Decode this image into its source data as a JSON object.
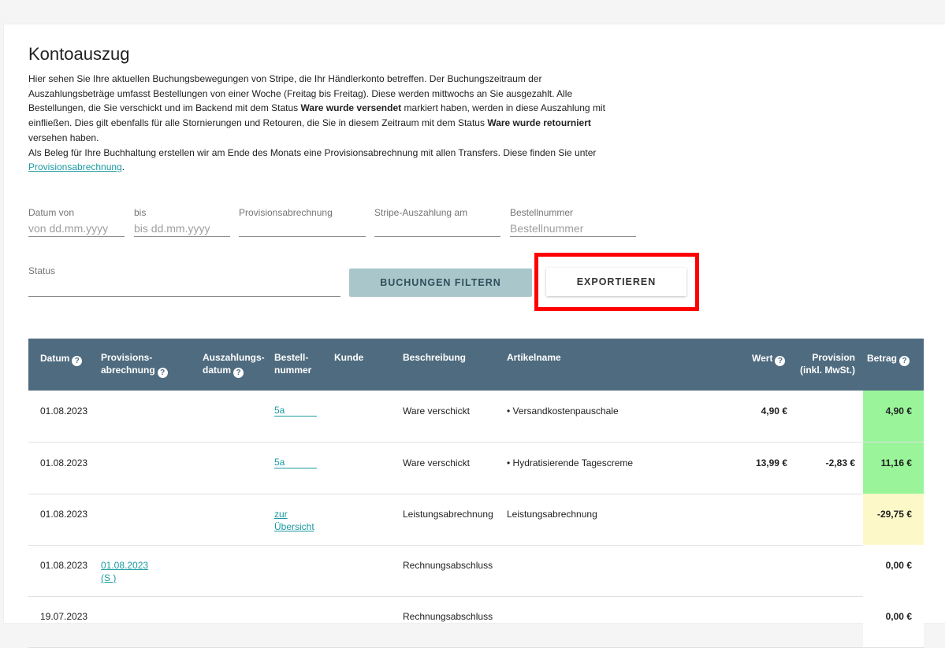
{
  "title": "Kontoauszug",
  "intro": {
    "p1": "Hier sehen Sie Ihre aktuellen Buchungsbewegungen von Stripe, die Ihr Händlerkonto betreffen. Der Buchungszeitraum der Auszahlungsbeträge umfasst Bestellungen von einer Woche (Freitag bis Freitag). Diese werden mittwochs an Sie ausgezahlt. Alle Bestellungen, die Sie verschickt und im Backend mit dem Status ",
    "b1": "Ware wurde versendet",
    "p2": " markiert haben, werden in diese Auszahlung mit einfließen. Dies gilt ebenfalls für alle Stornierungen und Retouren, die Sie in diesem Zeitraum mit dem Status ",
    "b2": "Ware wurde retourniert",
    "p3": " versehen haben.",
    "p4": "Als Beleg für Ihre Buchhaltung erstellen wir am Ende des Monats eine Provisionsabrechnung mit allen Transfers. Diese finden Sie unter ",
    "link": "Provisionsabrechnung",
    "p5": "."
  },
  "filters": {
    "datum_von": {
      "label": "Datum von",
      "placeholder": "von dd.mm.yyyy"
    },
    "bis": {
      "label": "bis",
      "placeholder": "bis dd.mm.yyyy"
    },
    "provisionsabrechnung": {
      "label": "Provisionsabrechnung",
      "value": ""
    },
    "stripe_auszahlung": {
      "label": "Stripe-Auszahlung am",
      "value": ""
    },
    "bestellnummer": {
      "label": "Bestellnummer",
      "placeholder": "Bestellnummer"
    },
    "status": {
      "label": "Status",
      "value": ""
    }
  },
  "buttons": {
    "filter": "BUCHUNGEN FILTERN",
    "export": "EXPORTIEREN"
  },
  "table": {
    "headers": {
      "datum": "Datum",
      "provisionsabrechnung_1": "Provisions-",
      "provisionsabrechnung_2": "abrechnung",
      "auszahlungsdatum_1": "Auszahlungs-",
      "auszahlungsdatum_2": "datum",
      "bestellnummer_1": "Bestell-",
      "bestellnummer_2": "nummer",
      "kunde": "Kunde",
      "beschreibung": "Beschreibung",
      "artikelname": "Artikelname",
      "wert": "Wert",
      "provision_1": "Provision",
      "provision_2": "(inkl. MwSt.)",
      "betrag": "Betrag"
    },
    "rows": [
      {
        "datum": "01.08.2023",
        "prov_1": "",
        "prov_2": "",
        "bestell_1": "5a",
        "bestell_2": "",
        "beschreibung": "Ware verschickt",
        "artikel": "• Versandkostenpauschale",
        "wert": "4,90 €",
        "provision": "",
        "betrag": "4,90 €",
        "betrag_color": "#9af59a"
      },
      {
        "datum": "01.08.2023",
        "prov_1": "",
        "prov_2": "",
        "bestell_1": "5a",
        "bestell_2": "",
        "beschreibung": "Ware verschickt",
        "artikel": "• Hydratisierende Tagescreme",
        "wert": "13,99 €",
        "provision": "-2,83 €",
        "betrag": "11,16 €",
        "betrag_color": "#9af59a"
      },
      {
        "datum": "01.08.2023",
        "prov_1": "",
        "prov_2": "",
        "bestell_1": "zur",
        "bestell_2": "Übersicht",
        "beschreibung": "Leistungsabrechnung",
        "artikel": "Leistungsabrechnung",
        "wert": "",
        "provision": "",
        "betrag": "-29,75 €",
        "betrag_color": "#fdf8c8"
      },
      {
        "datum": "01.08.2023",
        "prov_1": "01.08.2023",
        "prov_2": "(S             )",
        "bestell_1": "",
        "bestell_2": "",
        "beschreibung": "Rechnungsabschluss",
        "artikel": "",
        "wert": "",
        "provision": "",
        "betrag": "0,00 €",
        "betrag_color": "#ffffff"
      },
      {
        "datum": "19.07.2023",
        "prov_1": "",
        "prov_2": "",
        "bestell_1": "",
        "bestell_2": "",
        "beschreibung": "Rechnungsabschluss",
        "artikel": "",
        "wert": "",
        "provision": "",
        "betrag": "0,00 €",
        "betrag_color": "#ffffff"
      }
    ]
  },
  "colors": {
    "header_bg": "#4f6b7f",
    "link": "#1a9aa0",
    "highlight": "#ff0000",
    "filter_btn": "#a9c6cb"
  }
}
